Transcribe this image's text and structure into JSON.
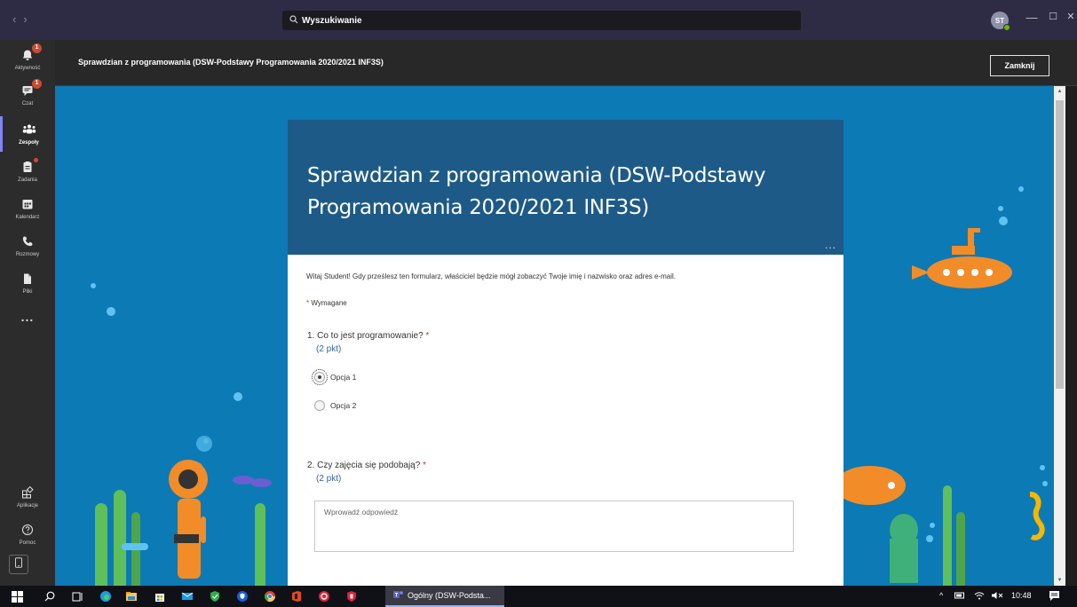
{
  "titlebar": {
    "nav_back": "‹",
    "nav_forward": "›",
    "search_icon": "search-icon",
    "search_value": "Wyszukiwanie",
    "avatar_initials": "ST",
    "minimize": "—",
    "maximize": "☐",
    "close": "✕"
  },
  "rail": {
    "items": [
      {
        "label": "Aktywność",
        "icon": "bell-icon",
        "badge": "1"
      },
      {
        "label": "Czat",
        "icon": "chat-icon",
        "badge": "1"
      },
      {
        "label": "Zespoły",
        "icon": "teams-icon",
        "active": true
      },
      {
        "label": "Zadania",
        "icon": "assignments-icon",
        "dot": true
      },
      {
        "label": "Kalendarz",
        "icon": "calendar-icon"
      },
      {
        "label": "Rozmowy",
        "icon": "phone-icon"
      },
      {
        "label": "Pliki",
        "icon": "files-icon"
      },
      {
        "label": "...",
        "icon": "more-icon"
      }
    ],
    "bottom": [
      {
        "label": "Aplikacje",
        "icon": "apps-icon"
      },
      {
        "label": "Pomoc",
        "icon": "help-icon"
      }
    ]
  },
  "panel": {
    "title": "Sprawdzian z programowania (DSW-Podstawy Programowania 2020/2021 INF3S)",
    "close_label": "Zamknij"
  },
  "form": {
    "title": "Sprawdzian z programowania (DSW-Podstawy Programowania 2020/2021 INF3S)",
    "more": "...",
    "intro": "Witaj Student! Gdy prześlesz ten formularz, właściciel będzie mógł zobaczyć Twoje imię i nazwisko oraz adres e-mail.",
    "required_star": "*",
    "required_label": "Wymagane",
    "questions": [
      {
        "title": "1. Co to jest programowanie?",
        "star": "*",
        "points": "(2 pkt)",
        "options": [
          {
            "label": "Opcja 1",
            "checked": true
          },
          {
            "label": "Opcja 2",
            "checked": false
          }
        ]
      },
      {
        "title": "2. Czy zajęcia się podobają?",
        "star": "*",
        "points": "(2 pkt)",
        "placeholder": "Wprowadź odpowiedź"
      }
    ]
  },
  "taskbar": {
    "active_app_label": "Ogólny (DSW-Podsta...",
    "time": "10:48",
    "tray_caret": "^"
  },
  "colors": {
    "ocean": "#0e7db8",
    "form_header": "#1d5a88",
    "accent": "#7f85f5",
    "submarine": "#f28c28"
  }
}
